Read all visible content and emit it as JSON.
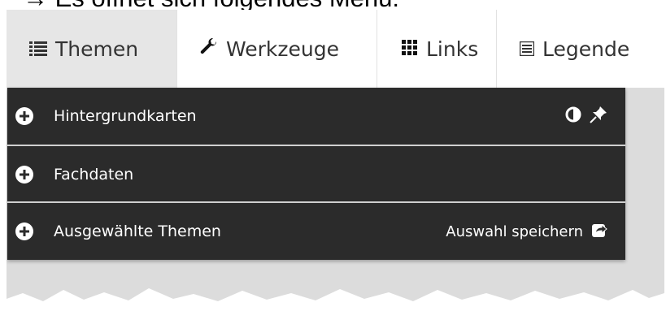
{
  "caption": "→ Es öffnet sich folgendes Menü:",
  "tabs": [
    {
      "label": "Themen",
      "icon": "list-icon"
    },
    {
      "label": "Werkzeuge",
      "icon": "wrench-icon"
    },
    {
      "label": "Links",
      "icon": "grid-icon"
    },
    {
      "label": "Legende",
      "icon": "legend-icon"
    }
  ],
  "menu": {
    "rows": [
      {
        "label": "Hintergrundkarten",
        "icons": [
          "contrast-icon",
          "pin-icon"
        ]
      },
      {
        "label": "Fachdaten"
      },
      {
        "label": "Ausgewählte Themen",
        "action": "Auswahl speichern",
        "action_icon": "share-icon"
      }
    ]
  },
  "colors": {
    "menu_bg": "#2b2b2b",
    "active_tab_bg": "#e6e6e6",
    "map_bg": "#dcdcdc"
  }
}
